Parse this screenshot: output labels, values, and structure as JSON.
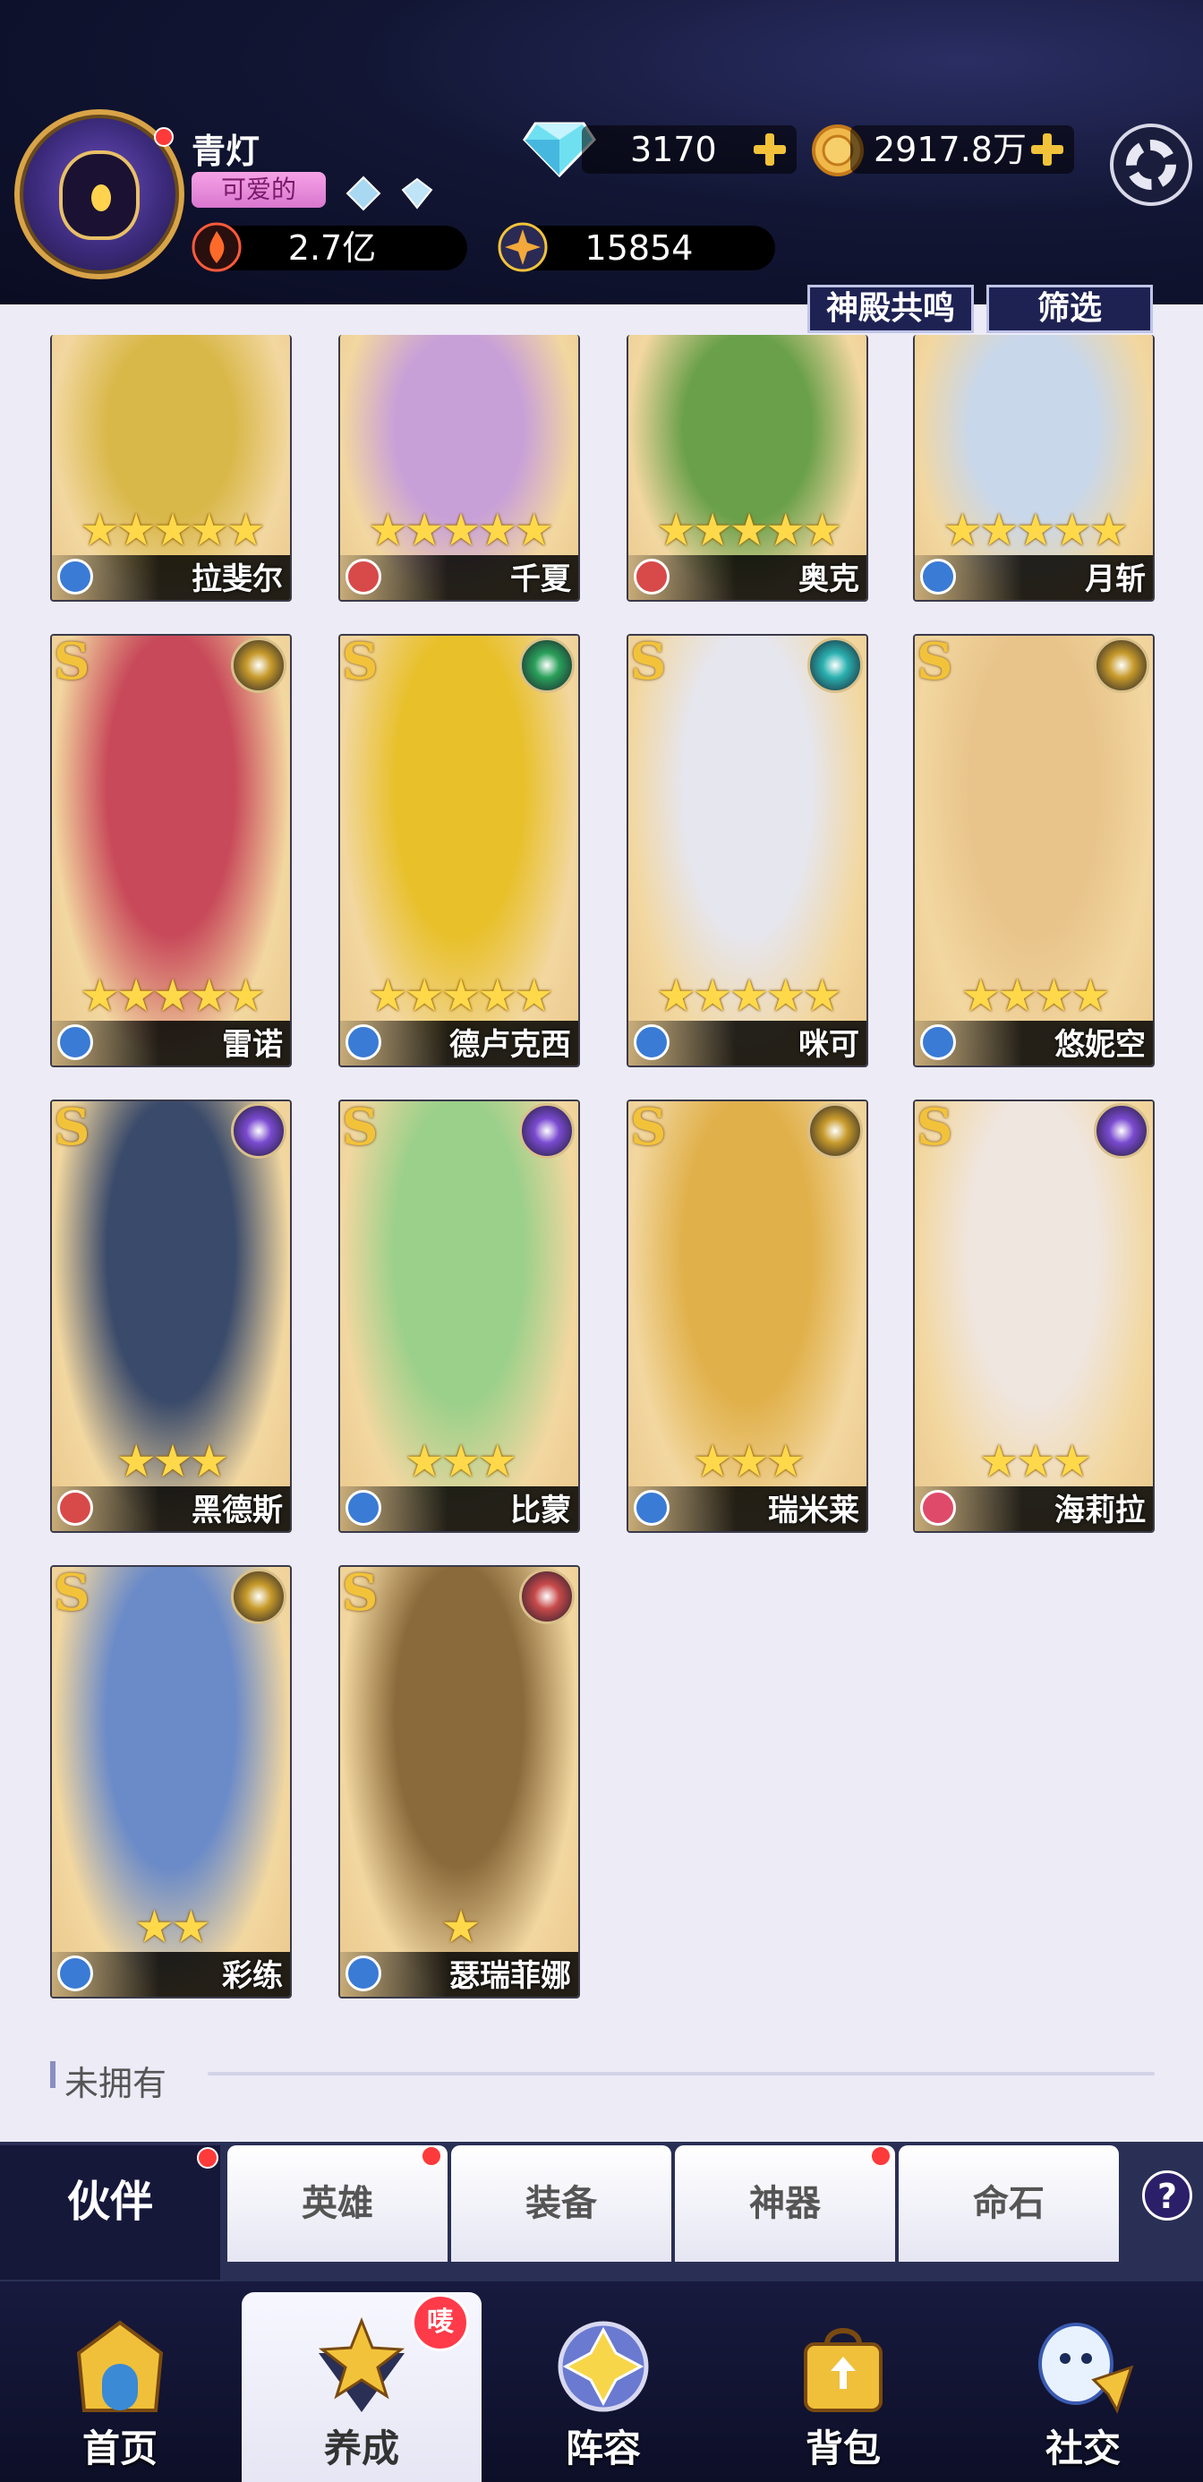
{
  "player": {
    "name": "青灯",
    "title": "可爱的",
    "power": "2.7亿",
    "score": "15854"
  },
  "resources": {
    "diamonds": "3170",
    "gold": "2917.8万"
  },
  "buttons": {
    "resonance": "神殿共鸣",
    "filter": "筛选"
  },
  "cards": [
    {
      "name": "拉斐尔",
      "stars": "★★★★★",
      "grade": "",
      "palette": "#d9b84a",
      "cls": "#3a7bd6"
    },
    {
      "name": "千夏",
      "stars": "★★★★★",
      "grade": "",
      "palette": "#c8a0d8",
      "cls": "#d84a4a"
    },
    {
      "name": "奥克",
      "stars": "★★★★★",
      "grade": "",
      "palette": "#6aa04a",
      "cls": "#d84a4a"
    },
    {
      "name": "月斩",
      "stars": "★★★★★",
      "grade": "",
      "palette": "#c9d7ea",
      "cls": "#3a7bd6"
    },
    {
      "name": "雷诺",
      "stars": "★★★★★",
      "grade": "S",
      "palette": "#c84a5a",
      "cls": "#3a7bd6",
      "elem": "#c79a2a"
    },
    {
      "name": "德卢克西",
      "stars": "★★★★★",
      "grade": "S",
      "palette": "#e8c02a",
      "cls": "#3a7bd6",
      "elem": "#2aa05a"
    },
    {
      "name": "咪可",
      "stars": "★★★★★",
      "grade": "S",
      "palette": "#e6e6ee",
      "cls": "#3a7bd6",
      "elem": "#2ab0b0"
    },
    {
      "name": "悠妮空",
      "stars": "★★★★",
      "grade": "S",
      "palette": "#e8c48a",
      "cls": "#3a7bd6",
      "elem": "#c79a2a"
    },
    {
      "name": "黑德斯",
      "stars": "★★★",
      "grade": "S",
      "palette": "#3a4a6a",
      "cls": "#d84a4a",
      "elem": "#7a4ad0"
    },
    {
      "name": "比蒙",
      "stars": "★★★",
      "grade": "S",
      "palette": "#9ad08a",
      "cls": "#3a7bd6",
      "elem": "#7a4ad0"
    },
    {
      "name": "瑞米莱",
      "stars": "★★★",
      "grade": "S",
      "palette": "#e0b04a",
      "cls": "#3a7bd6",
      "elem": "#c79a2a"
    },
    {
      "name": "海莉拉",
      "stars": "★★★",
      "grade": "S",
      "palette": "#efe6e0",
      "cls": "#e04a6a",
      "elem": "#7a4ad0"
    },
    {
      "name": "彩练",
      "stars": "★★",
      "grade": "S",
      "palette": "#6a8ac8",
      "cls": "#3a7bd6",
      "elem": "#c79a2a"
    },
    {
      "name": "瑟瑞菲娜",
      "stars": "★",
      "grade": "S",
      "palette": "#8a6a3a",
      "cls": "#3a7bd6",
      "elem": "#c84a4a"
    }
  ],
  "sections": {
    "not_owned": "未拥有"
  },
  "tabs": {
    "active": "伙伴",
    "items": [
      "英雄",
      "装备",
      "神器",
      "命石"
    ]
  },
  "bottom_nav": {
    "items": [
      "首页",
      "养成",
      "阵容",
      "背包",
      "社交"
    ],
    "badge": "唛"
  },
  "help": "?"
}
